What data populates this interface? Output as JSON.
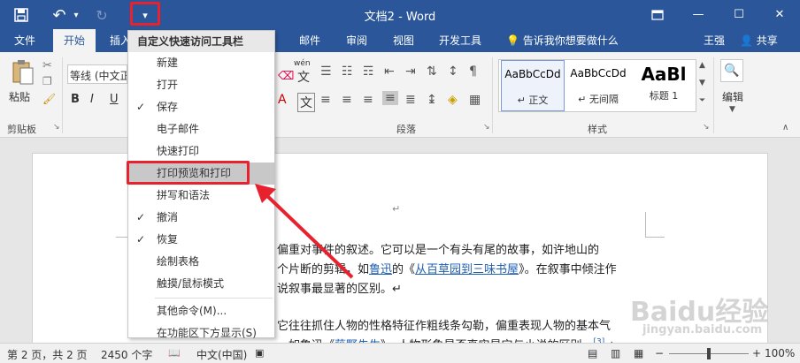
{
  "window": {
    "title": "文档2 - Word",
    "minimize": "—",
    "maximize": "☐",
    "close": "✕",
    "restore": "▣"
  },
  "qat": {
    "save": "💾",
    "undo": "↶",
    "undo_arrow": "▾",
    "redo": "↻",
    "customize": "▾"
  },
  "tabs": [
    {
      "label": "文件"
    },
    {
      "label": "开始"
    },
    {
      "label": "插入"
    },
    {
      "label": "邮件"
    },
    {
      "label": "审阅"
    },
    {
      "label": "视图"
    },
    {
      "label": "开发工具"
    }
  ],
  "tellme": "告诉我你想要做什么",
  "user": "王强",
  "share": "共享",
  "ribbon": {
    "paste": "粘贴",
    "clipboard": "剪贴板",
    "font_name": "等线 (中文正",
    "bold": "B",
    "italic": "I",
    "underline": "U",
    "wen": "wén",
    "wen_char": "文",
    "A_big": "A",
    "paragraph": "段落",
    "styles": "样式",
    "editing": "编辑",
    "style_items": [
      {
        "preview": "AaBbCcDd",
        "name": "↵ 正文"
      },
      {
        "preview": "AaBbCcDd",
        "name": "↵ 无间隔"
      },
      {
        "preview": "AaBl",
        "name": "标题 1"
      }
    ]
  },
  "menu": {
    "header": "自定义快速访问工具栏",
    "items": [
      {
        "label": "新建",
        "checked": false
      },
      {
        "label": "打开",
        "checked": false
      },
      {
        "label": "保存",
        "checked": true
      },
      {
        "label": "电子邮件",
        "checked": false
      },
      {
        "label": "快速打印",
        "checked": false
      },
      {
        "label": "打印预览和打印",
        "checked": false
      },
      {
        "label": "拼写和语法",
        "checked": false
      },
      {
        "label": "撤消",
        "checked": true
      },
      {
        "label": "恢复",
        "checked": true
      },
      {
        "label": "绘制表格",
        "checked": false
      },
      {
        "label": "触摸/鼠标模式",
        "checked": false
      },
      {
        "label": "其他命令(M)...",
        "checked": false
      },
      {
        "label": "在功能区下方显示(S)",
        "checked": false
      }
    ],
    "check_glyph": "✓"
  },
  "document": {
    "return_mark": "↵",
    "line1": "偏重对事件的叙述。它可以是一个有头有尾的故事，如许地山的",
    "line2_a": "个片断的剪辑，如",
    "line2_link1": "鲁迅",
    "line2_b": "的《",
    "line2_link2": "从百草园到三味书屋",
    "line2_c": "》。在叙事中倾注作",
    "line3": "说叙事最显著的区别。↵",
    "line4": "它往往抓住人物的性格特征作粗线条勾勒，偏重表现人物的基本气",
    "line5_a": "，如鲁迅《",
    "line5_link": "藤野先生",
    "line5_b": "》。人物形象是否真实是它与小说的区别。",
    "line5_ref": "[3]",
    "line5_end": "↵"
  },
  "status": {
    "page": "第 2 页，共 2 页",
    "words": "2450 个字",
    "language": "中文(中国)",
    "zoom": "100%",
    "zoom_minus": "−",
    "zoom_plus": "+"
  },
  "watermark": {
    "brand": "Baidu经验",
    "url": "jingyan.baidu.com"
  },
  "colors": {
    "accent": "#2b579a",
    "highlight_box": "#e8212e"
  }
}
